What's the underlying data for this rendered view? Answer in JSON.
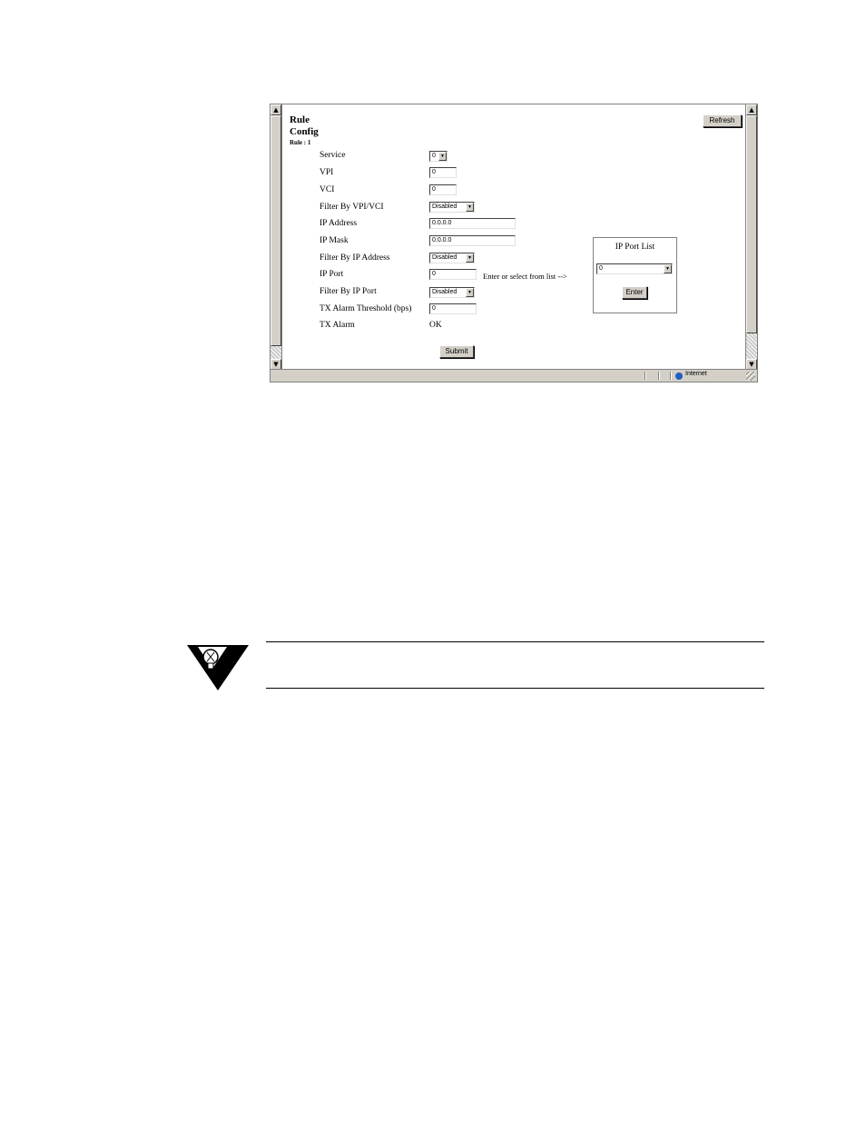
{
  "page": {
    "title_line1": "Rule",
    "title_line2": "Config",
    "subtitle": "Rule : 1",
    "refresh_label": "Refresh",
    "submit_label": "Submit"
  },
  "form": {
    "service": {
      "label": "Service",
      "value": "0"
    },
    "vpi": {
      "label": "VPI",
      "value": "0"
    },
    "vci": {
      "label": "VCI",
      "value": "0"
    },
    "filter_vpi_vci": {
      "label": "Filter By VPI/VCI",
      "value": "Disabled"
    },
    "ip_address": {
      "label": "IP Address",
      "value": "0.0.0.0"
    },
    "ip_mask": {
      "label": "IP Mask",
      "value": "0.0.0.0"
    },
    "filter_ip_address": {
      "label": "Filter By IP Address",
      "value": "Disabled"
    },
    "ip_port": {
      "label": "IP Port",
      "value": "0",
      "hint": "Enter or select from list -->"
    },
    "filter_ip_port": {
      "label": "Filter By IP Port",
      "value": "Disabled"
    },
    "tx_alarm_threshold": {
      "label": "TX Alarm Threshold (bps)",
      "value": "0"
    },
    "tx_alarm": {
      "label": "TX Alarm",
      "value": "OK"
    }
  },
  "ip_port_list": {
    "title": "IP Port List",
    "selected": "0",
    "enter_label": "Enter"
  },
  "status_bar": {
    "zone": "Internet"
  },
  "colors": {
    "chrome": "#d4d0c8",
    "zone_icon": "#1f5fbf"
  }
}
